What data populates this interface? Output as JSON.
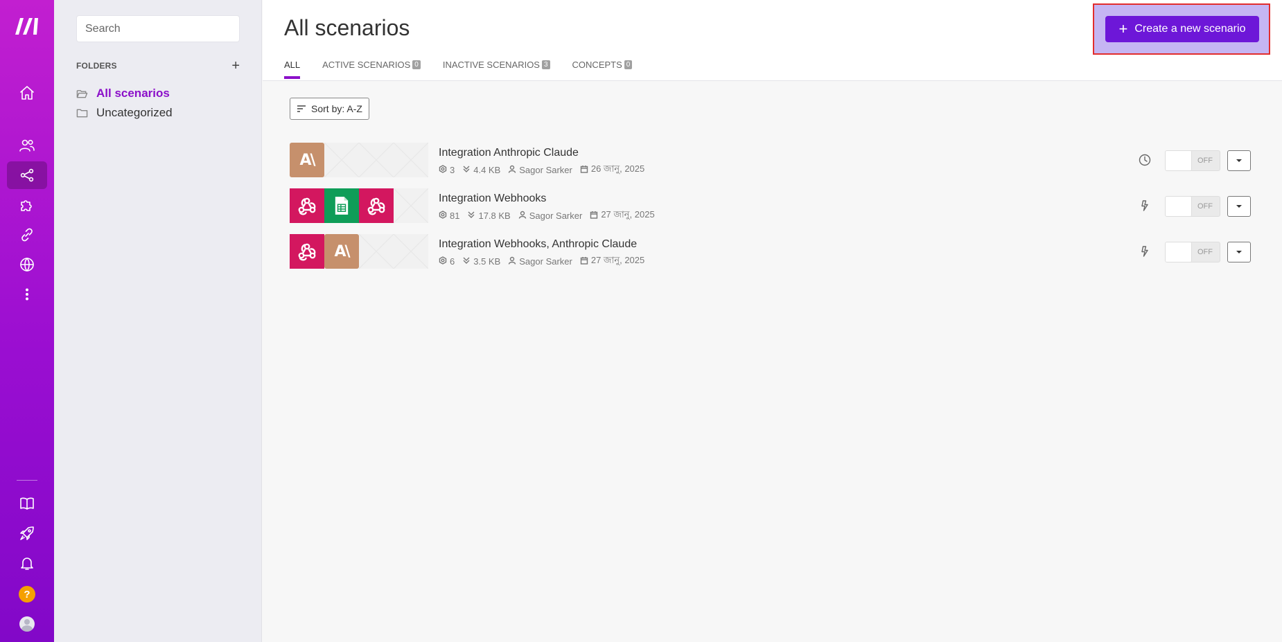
{
  "rail": {
    "items": [
      {
        "name": "home-icon"
      },
      {
        "name": "team-icon"
      },
      {
        "name": "scenarios-icon",
        "active": true
      },
      {
        "name": "apps-icon"
      },
      {
        "name": "connections-icon"
      },
      {
        "name": "webhooks-icon"
      },
      {
        "name": "more-icon"
      }
    ],
    "bottom": [
      {
        "name": "docs-icon"
      },
      {
        "name": "launch-icon"
      },
      {
        "name": "notifications-icon"
      }
    ],
    "help_label": "?"
  },
  "folders": {
    "search_placeholder": "Search",
    "heading": "FOLDERS",
    "add_label": "+",
    "items": [
      {
        "label": "All scenarios",
        "active": true
      },
      {
        "label": "Uncategorized",
        "active": false
      }
    ]
  },
  "header": {
    "title": "All scenarios",
    "create_label": "Create a new scenario",
    "tabs": [
      {
        "label": "ALL",
        "count": null,
        "active": true
      },
      {
        "label": "ACTIVE SCENARIOS",
        "count": "0",
        "active": false
      },
      {
        "label": "INACTIVE SCENARIOS",
        "count": "3",
        "active": false
      },
      {
        "label": "CONCEPTS",
        "count": "0",
        "active": false
      }
    ]
  },
  "sort_label": "Sort by: A-Z",
  "scenarios": [
    {
      "name": "Integration Anthropic Claude",
      "operations": "3",
      "size": "4.4 KB",
      "owner": "Sagor Sarker",
      "date": "26 জানু, 2025",
      "trigger": "schedule",
      "toggle": "OFF",
      "apps": [
        "anthropic",
        "empty",
        "empty",
        "empty"
      ]
    },
    {
      "name": "Integration Webhooks",
      "operations": "81",
      "size": "17.8 KB",
      "owner": "Sagor Sarker",
      "date": "27 জানু, 2025",
      "trigger": "instant",
      "toggle": "OFF",
      "apps": [
        "webhook",
        "sheets",
        "webhook",
        "empty"
      ]
    },
    {
      "name": "Integration Webhooks, Anthropic Claude",
      "operations": "6",
      "size": "3.5 KB",
      "owner": "Sagor Sarker",
      "date": "27 জানু, 2025",
      "trigger": "instant",
      "toggle": "OFF",
      "apps": [
        "webhook",
        "anthropic",
        "empty",
        "empty"
      ]
    }
  ],
  "colors": {
    "brand": "#8b10c9",
    "create_button": "#6d17d8",
    "anthropic": "#c6906c",
    "webhook": "#d3175f",
    "sheets": "#0f9d58"
  }
}
